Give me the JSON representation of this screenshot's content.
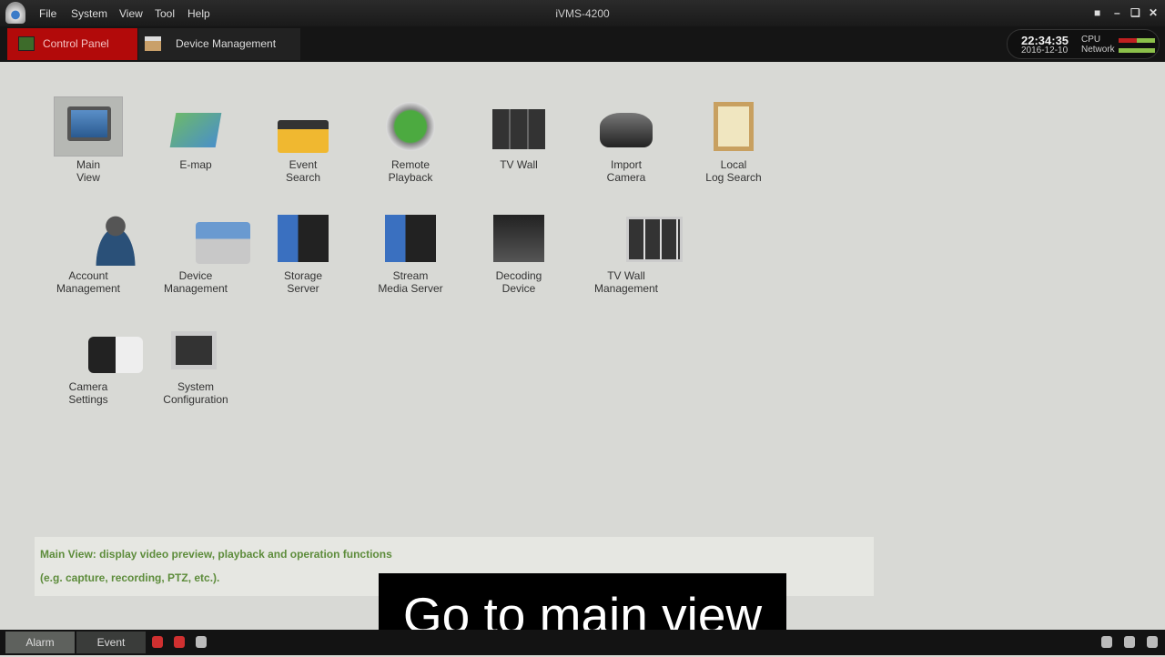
{
  "window": {
    "title": "iVMS-4200",
    "menu": [
      "File",
      "System",
      "View",
      "Tool",
      "Help"
    ]
  },
  "tabs": [
    {
      "label": "Control Panel",
      "active": true
    },
    {
      "label": "Device Management",
      "active": false
    }
  ],
  "status": {
    "time": "22:34:35",
    "date": "2016-12-10",
    "cpu_label": "CPU",
    "network_label": "Network"
  },
  "items": [
    {
      "line1": "Main",
      "line2": "View",
      "icon": "monitor-user-icon",
      "selected": true
    },
    {
      "line1": "E-map",
      "line2": "",
      "icon": "map-icon"
    },
    {
      "line1": "Event",
      "line2": "Search",
      "icon": "folder-film-icon"
    },
    {
      "line1": "Remote",
      "line2": "Playback",
      "icon": "playback-icon"
    },
    {
      "line1": "TV Wall",
      "line2": "",
      "icon": "tv-wall-icon"
    },
    {
      "line1": "Import",
      "line2": "Camera",
      "icon": "camera-film-icon"
    },
    {
      "line1": "Local",
      "line2": "Log Search",
      "icon": "clipboard-icon"
    },
    {
      "line1": "Account",
      "line2": "Management",
      "icon": "user-icon"
    },
    {
      "line1": "Device",
      "line2": "Management",
      "icon": "device-tray-icon"
    },
    {
      "line1": "Storage",
      "line2": "Server",
      "icon": "storage-server-icon"
    },
    {
      "line1": "Stream",
      "line2": "Media Server",
      "icon": "stream-server-icon"
    },
    {
      "line1": "Decoding",
      "line2": "Device",
      "icon": "decoder-icon"
    },
    {
      "line1": "TV Wall",
      "line2": "Management",
      "icon": "tv-wall-grid-icon"
    },
    {
      "line1": "Camera",
      "line2": "Settings",
      "icon": "camera-settings-icon"
    },
    {
      "line1": "System",
      "line2": "Configuration",
      "icon": "system-config-icon"
    }
  ],
  "info": {
    "line1": "Main View: display video preview, playback and operation functions",
    "line2": "(e.g. capture, recording, PTZ, etc.)."
  },
  "subtitle": "Go to main view",
  "bottom": {
    "tabs": [
      "Alarm",
      "Event"
    ]
  },
  "colors": {
    "accent": "#b20a0a",
    "info_text": "#5d8c3b"
  }
}
